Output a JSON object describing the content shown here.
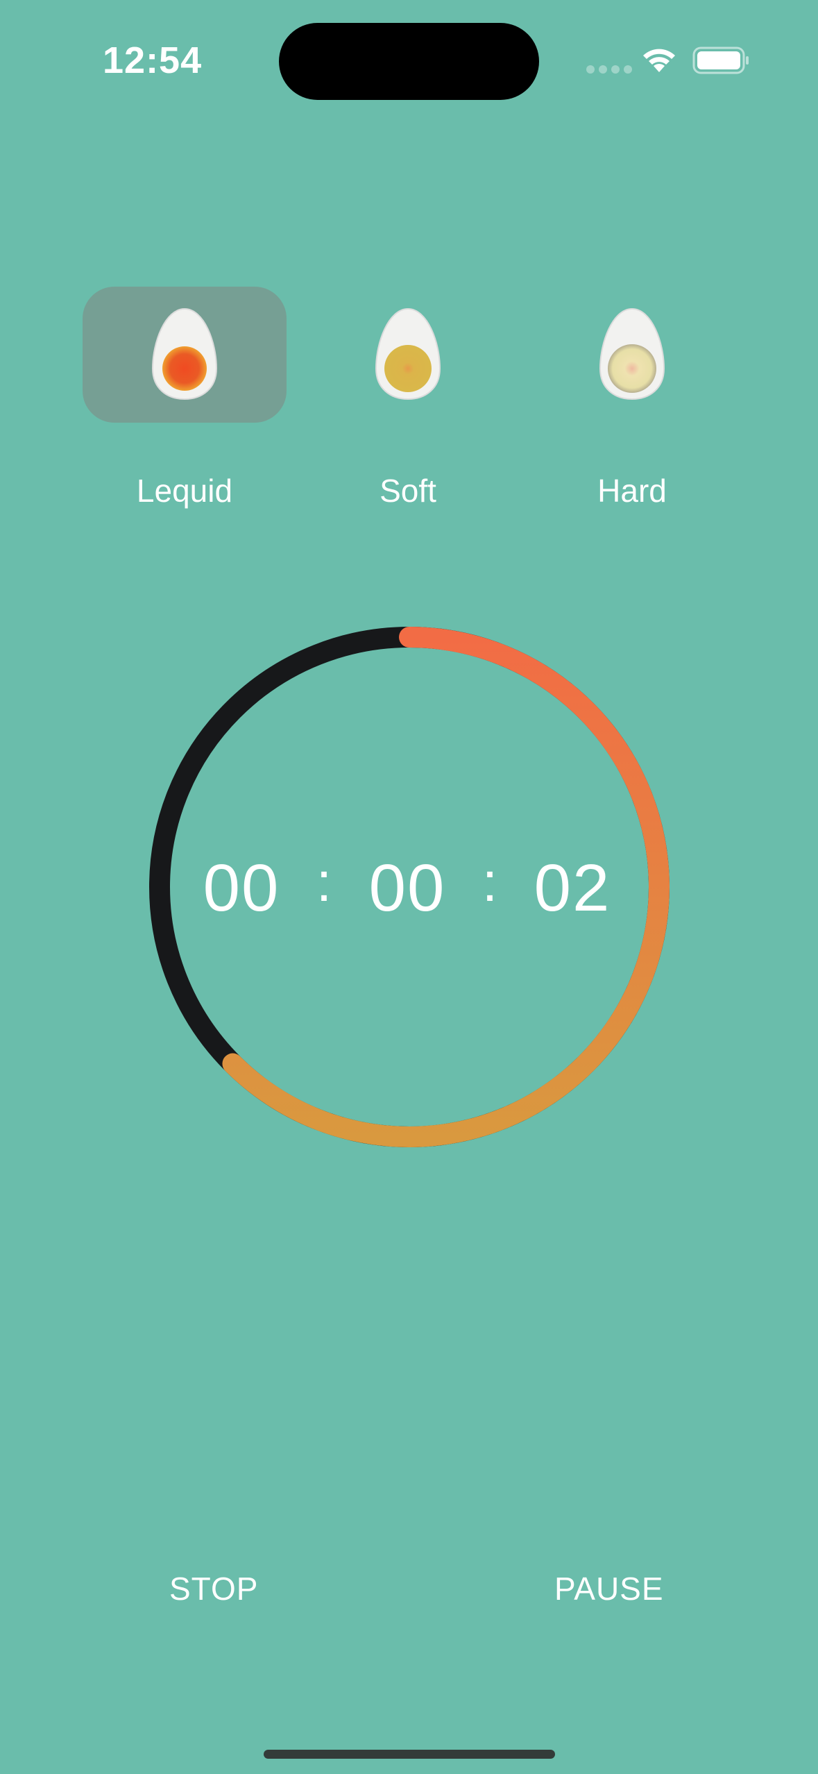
{
  "status_bar": {
    "time": "12:54"
  },
  "egg_options": [
    {
      "label": "Lequid",
      "selected": true,
      "yolk_color": "#ea5a25",
      "icon": "liquid-egg-icon"
    },
    {
      "label": "Soft",
      "selected": false,
      "yolk_color": "#d9b84a",
      "icon": "soft-egg-icon"
    },
    {
      "label": "Hard",
      "selected": false,
      "yolk_color": "#e7dfa7",
      "icon": "hard-egg-icon"
    }
  ],
  "timer": {
    "hours": "00",
    "minutes": "00",
    "seconds": "02",
    "separator": ":",
    "progress_fraction": 0.625,
    "track_color": "#17181a",
    "progress_start_color": "#f26c45",
    "progress_end_color": "#d9993f"
  },
  "actions": {
    "stop_label": "STOP",
    "pause_label": "PAUSE"
  },
  "colors": {
    "background": "#6abdab"
  }
}
